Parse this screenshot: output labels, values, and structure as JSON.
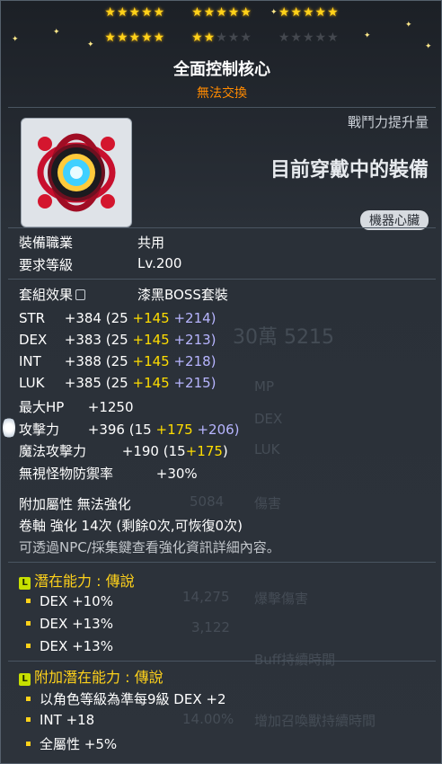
{
  "stars": {
    "total": 25,
    "filled": 22,
    "row1": [
      5,
      5,
      5
    ],
    "row2": [
      5,
      2,
      0
    ],
    "color_on": "#ffd21a",
    "color_off": "#44484f"
  },
  "item": {
    "name": "全面控制核心",
    "trade_status": "無法交換",
    "icon": "machine-heart-icon"
  },
  "compare": {
    "power_label": "戰鬥力提升量",
    "equipped_label": "目前穿戴中的裝備"
  },
  "category_tag": "機器心臟",
  "requirements": [
    {
      "label": "裝備職業",
      "value": "共用"
    },
    {
      "label": "要求等級",
      "value": "Lv.200"
    }
  ],
  "set_effect": {
    "label": "套組效果",
    "value": "漆黑BOSS套裝"
  },
  "stats": [
    {
      "name": "STR",
      "total": "+384",
      "base": "(25",
      "scroll": "+145",
      "star": "+214)"
    },
    {
      "name": "DEX",
      "total": "+383",
      "base": "(25",
      "scroll": "+145",
      "star": "+213)"
    },
    {
      "name": "INT",
      "total": "+388",
      "base": "(25",
      "scroll": "+145",
      "star": "+218)"
    },
    {
      "name": "LUK",
      "total": "+385",
      "base": "(25",
      "scroll": "+145",
      "star": "+215)"
    }
  ],
  "hp": {
    "name": "最大HP",
    "value": "+1250"
  },
  "attack": {
    "name": "攻擊力",
    "total": "+396",
    "base": "(15",
    "scroll": "+175",
    "star": "+206)"
  },
  "magic": {
    "name": "魔法攻擊力",
    "total": "+190",
    "base": "(15",
    "scroll": "+175",
    "close": ")"
  },
  "ignore_def": {
    "name": "無視怪物防禦率",
    "value": "+30%"
  },
  "extra": {
    "extra_attr": "附加屬性 無法強化",
    "scroll_info": "卷軸 強化 14次 (剩餘0次,可恢復0次)",
    "hint": "可透過NPC/採集鍵查看強化資訊詳細內容。"
  },
  "potential": {
    "header": "潛在能力 : 傳說",
    "lines": [
      "DEX +10%",
      "DEX +13%",
      "DEX +13%"
    ]
  },
  "additional_potential": {
    "header": "附加潛在能力 : 傳說",
    "lines": [
      "以角色等級為準每9級 DEX +2",
      "INT +18",
      "全屬性 +5%"
    ]
  },
  "background_ghost": [
    "30萬 5215",
    "MP",
    "DEX",
    "LUK",
    "5084",
    "傷害",
    "14,275",
    "爆擊傷害",
    "3,122",
    "Buff持續時間",
    "14.00%",
    "增加召喚獸持續時間"
  ]
}
